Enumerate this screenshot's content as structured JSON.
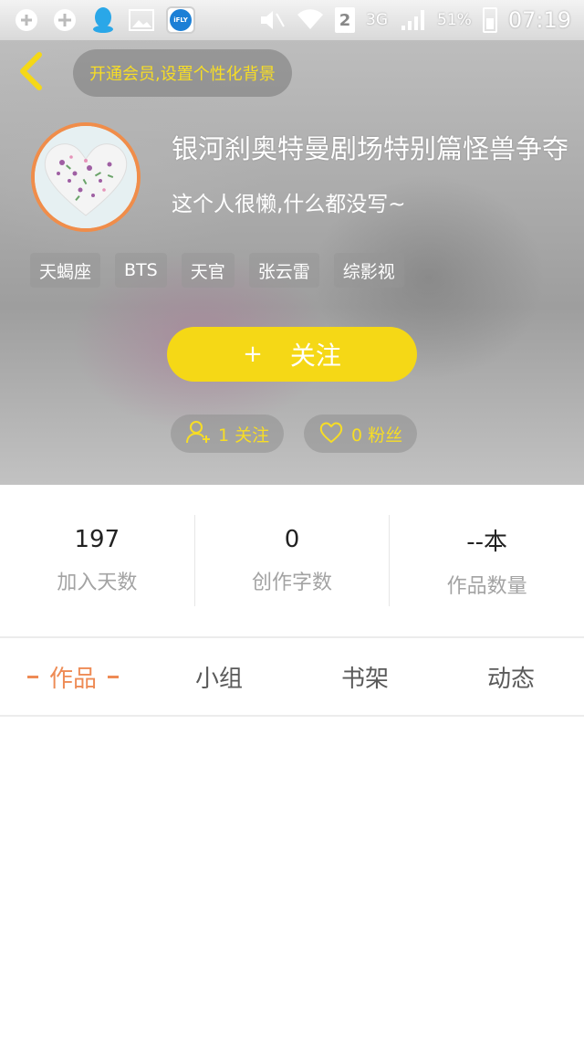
{
  "status_bar": {
    "sim_slot": "2",
    "network": "3G",
    "battery": "51%",
    "time": "07:19",
    "ifly_label": "iFLY",
    "icons": [
      "usb-icon",
      "add-circle-icon",
      "qq-icon",
      "image-icon",
      "ifly-app-icon",
      "mute-icon",
      "wifi-icon",
      "signal-icon",
      "battery-icon"
    ]
  },
  "header": {
    "vip_promo": "开通会员,设置个性化背景",
    "username": "银河刹奥特曼剧场特别篇怪兽争夺",
    "bio": "这个人很懒,什么都没写~",
    "tags": [
      "天蝎座",
      "BTS",
      "天官",
      "张云雷",
      "综影视"
    ],
    "follow_label": "关注",
    "follow_plus": "+",
    "following_text": "1 关注",
    "fans_text": "0 粉丝"
  },
  "stats": [
    {
      "value": "197",
      "label": "加入天数"
    },
    {
      "value": "0",
      "label": "创作字数"
    },
    {
      "value": "--本",
      "label": "作品数量"
    }
  ],
  "tabs": [
    {
      "label": "作品",
      "active": true
    },
    {
      "label": "小组",
      "active": false
    },
    {
      "label": "书架",
      "active": false
    },
    {
      "label": "动态",
      "active": false
    }
  ],
  "colors": {
    "accent_yellow": "#f5d816",
    "accent_orange": "#ee8b55",
    "avatar_border": "#f08d4a"
  }
}
